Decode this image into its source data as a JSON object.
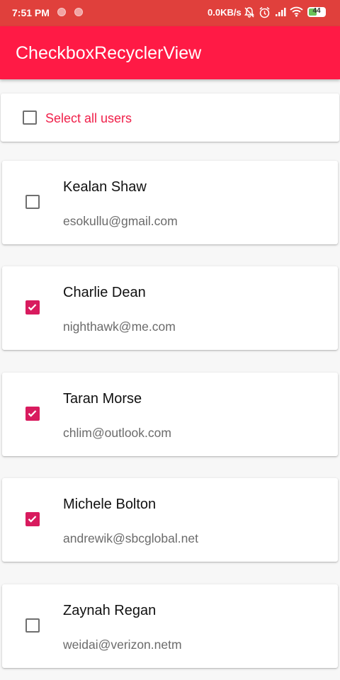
{
  "status_bar": {
    "time": "7:51 PM",
    "network_speed": "0.0KB/s",
    "battery_level": "44",
    "icons": [
      "notification-dot-icon",
      "notification-dot-icon",
      "mute-icon",
      "alarm-icon",
      "signal-icon",
      "wifi-icon",
      "battery-icon"
    ]
  },
  "app_bar": {
    "title": "CheckboxRecyclerView"
  },
  "select_all": {
    "label": "Select all users",
    "checked": false
  },
  "users": [
    {
      "name": "Kealan Shaw",
      "email": "esokullu@gmail.com",
      "checked": false
    },
    {
      "name": "Charlie Dean",
      "email": "nighthawk@me.com",
      "checked": true
    },
    {
      "name": "Taran Morse",
      "email": "chlim@outlook.com",
      "checked": true
    },
    {
      "name": "Michele Bolton",
      "email": "andrewik@sbcglobal.net",
      "checked": true
    },
    {
      "name": "Zaynah Regan",
      "email": "weidai@verizon.netm",
      "checked": false
    }
  ],
  "colors": {
    "status_bar": "#e0403c",
    "app_bar": "#ff1a45",
    "accent": "#f0204a",
    "checkbox_checked": "#d81b5e"
  }
}
